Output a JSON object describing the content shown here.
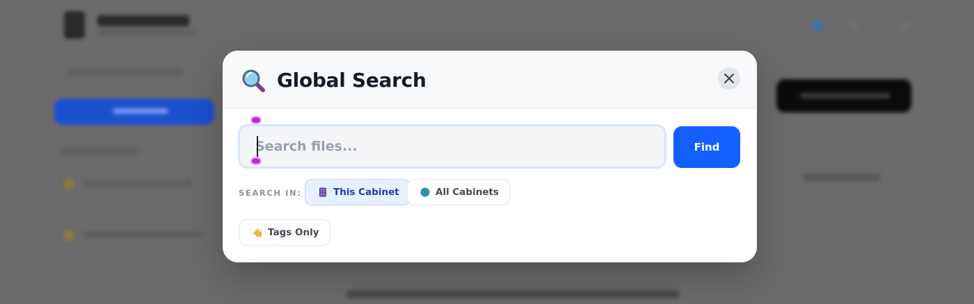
{
  "modal": {
    "title": "Global Search",
    "close_label": "×"
  },
  "search": {
    "placeholder": "Search files...",
    "value": "",
    "button_label": "Find"
  },
  "scope": {
    "label": "SEARCH IN:",
    "options": [
      {
        "label": "This Cabinet",
        "icon": "cabinet-icon",
        "selected": true
      },
      {
        "label": "All Cabinets",
        "icon": "globe-icon",
        "selected": false
      },
      {
        "label": "Tags Only",
        "icon": "tag-icon",
        "selected": false
      }
    ]
  },
  "colors": {
    "accent": "#1460ff",
    "selected_chip_bg": "#e7f0fe",
    "selected_chip_text": "#1d3fa6",
    "backdrop": "#6b6b6b"
  }
}
